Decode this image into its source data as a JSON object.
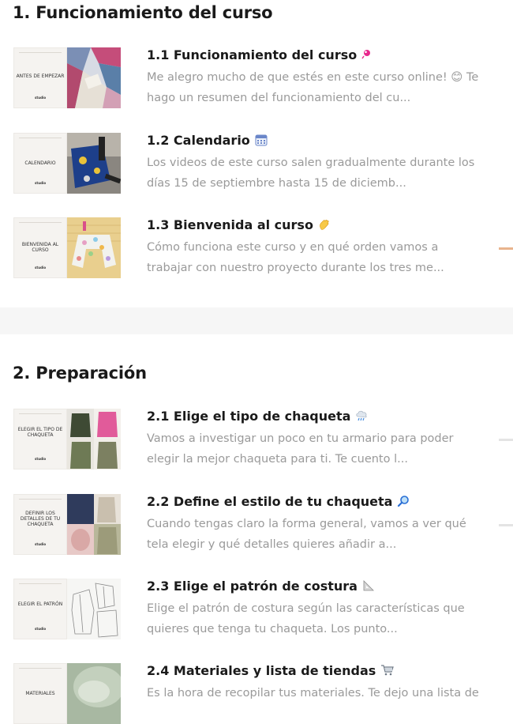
{
  "sections": [
    {
      "title": "1. Funcionamiento del curso",
      "lessons": [
        {
          "title": "1.1 Funcionamiento del curso",
          "emoji": "pink-sparkle",
          "thumb_label": "ANTES DE EMPEZAR",
          "description": "Me alegro mucho de que estés en este curso online! 😊 Te hago un resumen del funcionamiento del cu..."
        },
        {
          "title": "1.2 Calendario",
          "emoji": "calendar",
          "thumb_label": "CALENDARIO",
          "description": "Los videos de este curso salen gradualmente durante los días 15 de septiembre hasta 15 de diciemb..."
        },
        {
          "title": "1.3 Bienvenida al curso",
          "emoji": "waving-hand",
          "thumb_label": "BIENVENIDA AL CURSO",
          "description": "Cómo funciona este curso y en qué orden vamos a trabajar con nuestro proyecto durante los tres me..."
        }
      ]
    },
    {
      "title": "2. Preparación",
      "lessons": [
        {
          "title": "2.1 Elige el tipo de chaqueta",
          "emoji": "cloud-rain",
          "thumb_label": "ELEGIR EL TIPO DE CHAQUETA",
          "description": "Vamos a investigar un poco en tu armario para poder elegir la mejor chaqueta para ti. Te cuento l..."
        },
        {
          "title": "2.2 Define el estilo de tu chaqueta",
          "emoji": "magnifier",
          "thumb_label": "DEFINIR LOS DETALLES DE TU CHAQUETA",
          "description": "Cuando tengas claro la forma general, vamos a ver qué tela elegir y qué detalles quieres añadir a..."
        },
        {
          "title": "2.3 Elige el patrón de costura",
          "emoji": "triangle-ruler",
          "thumb_label": "ELEGIR EL PATRÓN",
          "description": "Elige el patrón de costura según las características que quieres que tenga tu chaqueta. Los punto..."
        },
        {
          "title": "2.4 Materiales y lista de tiendas",
          "emoji": "shopping-cart",
          "thumb_label": "MATERIALES",
          "description": "Es la hora de recopilar tus materiales. Te dejo una lista de"
        }
      ]
    }
  ],
  "colors": {
    "title": "#1a1a1a",
    "description": "#9a9a9a",
    "band": "#f6f6f6",
    "accent": "#e9b48d"
  }
}
